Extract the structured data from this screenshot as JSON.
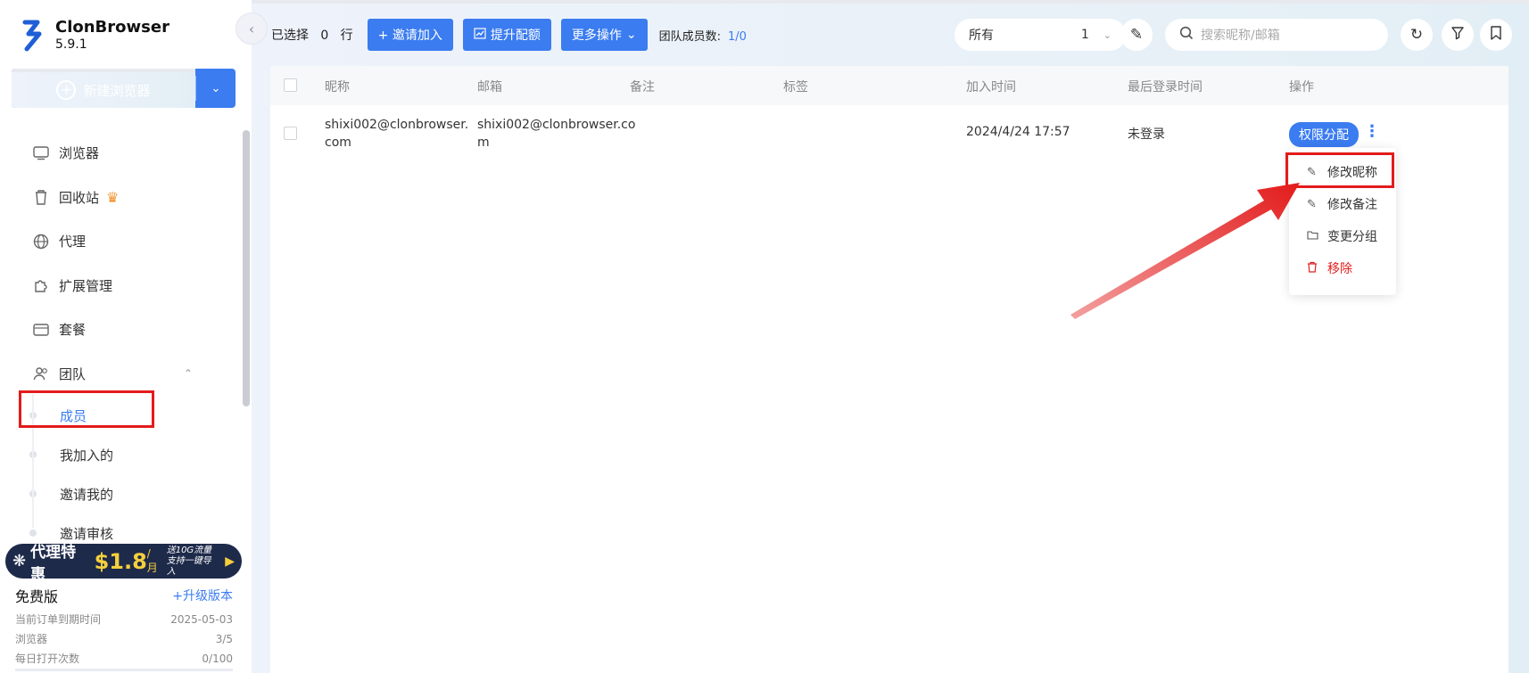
{
  "brand": {
    "name": "ClonBrowser",
    "version": "5.9.1"
  },
  "sidebar": {
    "new_browser_label": "新建浏览器",
    "items": [
      {
        "label": "浏览器",
        "icon": "browser-icon"
      },
      {
        "label": "回收站",
        "icon": "trash-icon",
        "badge_icon": "crown-icon"
      },
      {
        "label": "代理",
        "icon": "globe-icon"
      },
      {
        "label": "扩展管理",
        "icon": "puzzle-icon"
      },
      {
        "label": "套餐",
        "icon": "wallet-icon"
      },
      {
        "label": "团队",
        "icon": "team-icon",
        "expanded": true
      }
    ],
    "team_sub": [
      {
        "label": "成员",
        "active": true
      },
      {
        "label": "我加入的"
      },
      {
        "label": "邀请我的"
      },
      {
        "label": "邀请审核"
      }
    ]
  },
  "promo": {
    "title": "代理特惠",
    "price": "$1.8",
    "per": "/月",
    "line1": "送10G流量",
    "line2": "支持一键导入"
  },
  "plan": {
    "name": "免费版",
    "upgrade": "+升级版本",
    "rows": [
      {
        "label": "当前订单到期时间",
        "value": "2025-05-03"
      },
      {
        "label": "浏览器",
        "value": "3/5"
      },
      {
        "label": "每日打开次数",
        "value": "0/100"
      }
    ]
  },
  "toolbar": {
    "selected_prefix": "已选择",
    "selected_count": "0",
    "selected_suffix": "行",
    "invite_label": "+ 邀请加入",
    "quota_label": "提升配额",
    "more_label": "更多操作",
    "members_label": "团队成员数:",
    "members_count": "1/0",
    "filter_label": "所有",
    "filter_value": "1",
    "search_placeholder": "搜索昵称/邮箱"
  },
  "table": {
    "columns": [
      "昵称",
      "邮箱",
      "备注",
      "标签",
      "加入时间",
      "最后登录时间",
      "操作"
    ],
    "rows": [
      {
        "nickname_l1": "shixi002@clonbrowser.",
        "nickname_l2": "com",
        "email_l1": "shixi002@clonbrowser.co",
        "email_l2": "m",
        "remark": "",
        "tags": "",
        "joined": "2024/4/24 17:57",
        "last_login": "未登录",
        "action_label": "权限分配"
      }
    ]
  },
  "row_menu": [
    {
      "label": "修改昵称",
      "icon": "edit-icon"
    },
    {
      "label": "修改备注",
      "icon": "edit-icon"
    },
    {
      "label": "变更分组",
      "icon": "folder-icon"
    },
    {
      "label": "移除",
      "icon": "trash-icon",
      "danger": true
    }
  ],
  "colors": {
    "accent": "#3b7cf0",
    "highlight": "#e31b1b",
    "danger": "#e02020"
  }
}
